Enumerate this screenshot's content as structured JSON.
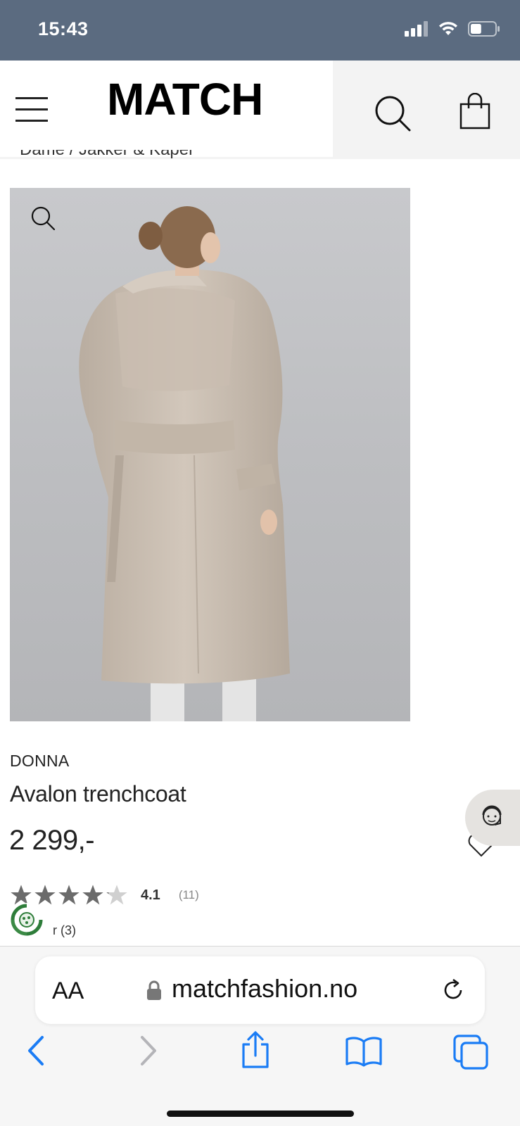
{
  "status_bar": {
    "time": "15:43",
    "battery_level": 0.45
  },
  "header": {
    "logo": "MATCH",
    "icons": [
      "menu-icon",
      "search-icon",
      "shopping-bag-icon"
    ]
  },
  "breadcrumb": {
    "text": "Dame / Jakker & Kåper"
  },
  "product": {
    "brand": "DONNA",
    "name": "Avalon trenchcoat",
    "price": "2 299,-",
    "rating": {
      "value": "4.1",
      "count": "(11)",
      "stars": 4.1,
      "max": 5
    },
    "eco_label": "r (3)"
  },
  "browser": {
    "text_size_button": "AA",
    "url": "matchfashion.no",
    "toolbar": [
      "back-icon",
      "forward-icon",
      "share-icon",
      "bookmarks-icon",
      "tabs-icon"
    ]
  },
  "colors": {
    "status_bar": "#5b6b80",
    "ios_blue": "#1a7cf5",
    "image_bg": "#c0c1c4"
  }
}
